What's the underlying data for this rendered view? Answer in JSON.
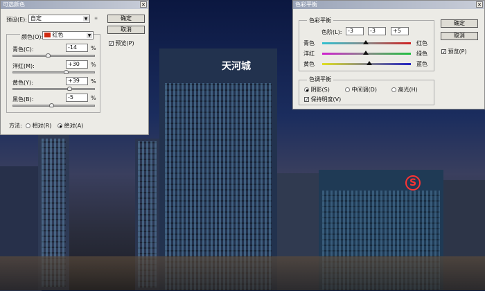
{
  "selective_color": {
    "title": "可选颜色",
    "preset_label": "预设(E):",
    "preset_value": "自定",
    "ok": "确定",
    "cancel": "取消",
    "preview": "预览(P)",
    "colors_label": "颜色(O):",
    "colors_value": "红色",
    "swatch": "#d02a10",
    "sliders": [
      {
        "label": "青色(C):",
        "value": "-14",
        "pct": "%",
        "pos": 0.43
      },
      {
        "label": "洋红(M):",
        "value": "+30",
        "pct": "%",
        "pos": 0.65
      },
      {
        "label": "黄色(Y):",
        "value": "+39",
        "pct": "%",
        "pos": 0.69
      },
      {
        "label": "黑色(B):",
        "value": "-5",
        "pct": "%",
        "pos": 0.47
      }
    ],
    "method_label": "方法:",
    "relative": "相对(R)",
    "absolute": "绝对(A)"
  },
  "color_balance": {
    "title": "色彩平衡",
    "group1": "色彩平衡",
    "levels_label": "色阶(L):",
    "levels": [
      "-3",
      "-3",
      "+5"
    ],
    "ok": "确定",
    "cancel": "取消",
    "preview": "预览(P)",
    "sliders": [
      {
        "left": "青色",
        "right": "红色",
        "pos": 0.49,
        "c1": "#30c0d0",
        "c2": "#d02020"
      },
      {
        "left": "洋红",
        "right": "绿色",
        "pos": 0.49,
        "c1": "#d020d0",
        "c2": "#20c040"
      },
      {
        "left": "黄色",
        "right": "蓝色",
        "pos": 0.53,
        "c1": "#e0e020",
        "c2": "#2020c0"
      }
    ],
    "group2": "色调平衡",
    "shadows": "阴影(S)",
    "midtones": "中间调(D)",
    "highlights": "高光(H)",
    "preserve": "保持明度(V)"
  },
  "photo": {
    "sign1": "天河城",
    "sign2": "S"
  }
}
